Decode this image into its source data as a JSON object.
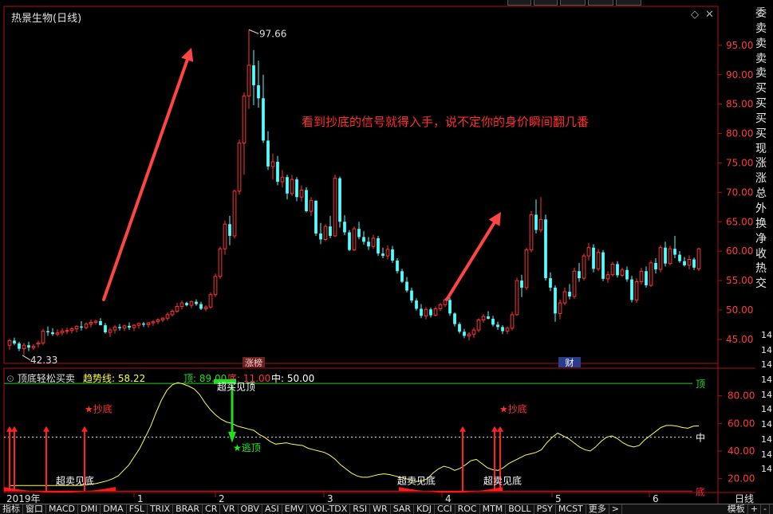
{
  "window": {
    "stock_title": "热景生物(日线)",
    "panel_controls": [
      "◇",
      "✕"
    ]
  },
  "annotation": {
    "text": "看到抄底的信号就得入手，说不定你的身价瞬间翻几番",
    "color": "#ff2d2d"
  },
  "right_panel": {
    "labels": [
      "委",
      "卖",
      "卖",
      "卖",
      "卖",
      "买",
      "买",
      "买",
      "买",
      "现",
      "涨",
      "涨",
      "总",
      "外",
      "换",
      "净",
      "收",
      "热",
      "交"
    ],
    "extra_numbers": [
      "14",
      "14",
      "14",
      "14",
      "14",
      "14",
      "14",
      "14",
      "14",
      "14"
    ]
  },
  "price_panel_labels": {
    "high_label": "97.66",
    "low_label": "42.33",
    "badge_zhangbang": "涨榜",
    "badge_cai": "财"
  },
  "indicator": {
    "name": "顶底轻松买卖",
    "trend_label": "趋势线: 58.22",
    "top_label": "顶: 89.00",
    "bottom_label": "底: 11.00",
    "mid_label": "中: 50.00",
    "line_top": "顶",
    "line_mid": "中",
    "line_bottom": "底",
    "signals": {
      "chaodi_1": "★抄底",
      "chaodi_2": "★抄底",
      "taoding": "★逃顶",
      "chaomai_top": "超买见顶",
      "chaomai_bottom_1": "超卖见底",
      "chaomai_bottom_2": "超卖见底",
      "chaomai_bottom_3": "超卖见底"
    }
  },
  "timeline": {
    "year": "2019年",
    "months": [
      "1",
      "2",
      "3",
      "4",
      "5",
      "6"
    ]
  },
  "bottom_tabs": [
    "指标",
    "窗口",
    "MACD",
    "DMI",
    "DMA",
    "FSL",
    "TRIX",
    "BRAR",
    "CR",
    "VR",
    "OBV",
    "ASI",
    "EMV",
    "VOL-TDX",
    "RSI",
    "WR",
    "SAR",
    "KDJ",
    "CCI",
    "ROC",
    "MTM",
    "BOLL",
    "PSY",
    "MCST",
    "更多",
    ">"
  ],
  "bottom_right_tabs": [
    "模板",
    "+",
    "-"
  ],
  "right_bottom_label": "日线",
  "chart_data": [
    {
      "type": "candlestick",
      "title": "热景生物(日线)",
      "ylim": [
        42,
        100
      ],
      "y_ticks": [
        45.0,
        50.0,
        55.0,
        60.0,
        65.0,
        70.0,
        75.0,
        80.0,
        85.0,
        90.0,
        95.0
      ],
      "colors": {
        "up": "#ff3232",
        "down": "#54ffff"
      },
      "candles": [
        [
          44.0,
          45.1,
          43.2,
          44.8
        ],
        [
          44.8,
          45.3,
          44.0,
          44.3
        ],
        [
          44.3,
          44.6,
          43.0,
          43.4
        ],
        [
          43.4,
          44.4,
          42.3,
          44.0
        ],
        [
          44.0,
          44.6,
          43.0,
          43.6
        ],
        [
          43.6,
          44.2,
          43.2,
          43.8
        ],
        [
          44.2,
          44.8,
          43.6,
          44.4
        ],
        [
          44.4,
          46.8,
          44.0,
          46.4
        ],
        [
          46.4,
          47.2,
          45.6,
          46.2
        ],
        [
          46.2,
          46.9,
          45.6,
          45.9
        ],
        [
          45.9,
          46.7,
          45.5,
          46.1
        ],
        [
          46.1,
          46.9,
          45.7,
          46.4
        ],
        [
          46.4,
          47.0,
          45.9,
          46.5
        ],
        [
          46.5,
          47.1,
          46.0,
          46.8
        ],
        [
          46.8,
          47.4,
          46.2,
          47.2
        ],
        [
          47.2,
          48.1,
          46.5,
          47.0
        ],
        [
          47.0,
          47.9,
          46.7,
          47.6
        ],
        [
          47.6,
          48.4,
          47.0,
          47.9
        ],
        [
          47.9,
          48.3,
          47.5,
          48.1
        ],
        [
          48.1,
          48.6,
          47.7,
          47.4
        ],
        [
          47.4,
          47.8,
          46.0,
          46.2
        ],
        [
          46.2,
          47.0,
          45.4,
          46.6
        ],
        [
          46.6,
          47.4,
          46.0,
          47.1
        ],
        [
          47.1,
          47.6,
          46.5,
          46.9
        ],
        [
          46.9,
          47.5,
          46.4,
          47.3
        ],
        [
          47.3,
          47.9,
          46.6,
          47.0
        ],
        [
          47.0,
          47.6,
          46.4,
          47.4
        ],
        [
          47.4,
          47.9,
          46.8,
          47.7
        ],
        [
          47.7,
          48.0,
          47.1,
          47.5
        ],
        [
          47.5,
          48.0,
          47.0,
          47.8
        ],
        [
          47.8,
          48.3,
          47.3,
          48.0
        ],
        [
          48.0,
          48.6,
          47.6,
          48.3
        ],
        [
          48.3,
          48.8,
          47.9,
          48.6
        ],
        [
          48.6,
          49.6,
          48.2,
          49.2
        ],
        [
          49.2,
          50.1,
          48.9,
          49.8
        ],
        [
          49.8,
          51.2,
          49.5,
          50.6
        ],
        [
          50.6,
          51.6,
          50.1,
          51.2
        ],
        [
          51.2,
          51.4,
          50.6,
          50.8
        ],
        [
          50.8,
          51.6,
          50.3,
          51.4
        ],
        [
          51.4,
          51.8,
          50.7,
          51.0
        ],
        [
          51.0,
          51.4,
          50.0,
          50.2
        ],
        [
          50.2,
          50.8,
          49.8,
          50.5
        ],
        [
          50.5,
          53.0,
          50.2,
          52.6
        ],
        [
          52.6,
          56.2,
          52.2,
          55.7
        ],
        [
          55.7,
          60.8,
          55.3,
          60.4
        ],
        [
          60.4,
          65.2,
          59.4,
          64.6
        ],
        [
          64.6,
          66.0,
          61.0,
          62.6
        ],
        [
          62.6,
          70.5,
          62.2,
          70.2
        ],
        [
          70.2,
          79.0,
          69.6,
          78.4
        ],
        [
          78.4,
          87.0,
          73.0,
          86.4
        ],
        [
          86.4,
          97.66,
          84.2,
          91.6
        ],
        [
          91.6,
          94.2,
          84.8,
          88.2
        ],
        [
          88.2,
          92.4,
          84.4,
          86.0
        ],
        [
          86.0,
          90.0,
          78.4,
          78.8
        ],
        [
          78.8,
          80.4,
          73.8,
          74.4
        ],
        [
          74.4,
          76.6,
          72.2,
          75.2
        ],
        [
          75.2,
          76.2,
          71.2,
          71.8
        ],
        [
          71.8,
          73.8,
          70.8,
          72.6
        ],
        [
          72.6,
          73.0,
          68.8,
          69.8
        ],
        [
          69.8,
          73.0,
          69.4,
          72.2
        ],
        [
          72.2,
          72.6,
          68.5,
          69.2
        ],
        [
          69.2,
          71.2,
          68.4,
          70.4
        ],
        [
          70.4,
          70.9,
          66.6,
          66.8
        ],
        [
          66.8,
          69.2,
          66.0,
          68.6
        ],
        [
          68.6,
          68.6,
          62.6,
          63.0
        ],
        [
          63.0,
          64.8,
          61.2,
          62.0
        ],
        [
          62.0,
          64.6,
          61.7,
          64.2
        ],
        [
          64.2,
          66.0,
          62.2,
          62.6
        ],
        [
          62.6,
          73.0,
          62.4,
          72.4
        ],
        [
          72.4,
          72.7,
          64.0,
          65.0
        ],
        [
          65.0,
          66.1,
          62.7,
          63.2
        ],
        [
          63.2,
          63.6,
          60.0,
          60.2
        ],
        [
          60.2,
          64.2,
          60.0,
          63.8
        ],
        [
          63.8,
          65.0,
          62.0,
          62.4
        ],
        [
          62.4,
          63.4,
          61.1,
          61.6
        ],
        [
          61.6,
          62.4,
          60.2,
          60.8
        ],
        [
          60.8,
          62.8,
          60.4,
          62.2
        ],
        [
          62.2,
          62.6,
          59.2,
          59.6
        ],
        [
          59.6,
          60.6,
          58.8,
          59.2
        ],
        [
          59.2,
          61.0,
          58.6,
          60.3
        ],
        [
          60.3,
          60.9,
          58.0,
          58.4
        ],
        [
          58.4,
          58.8,
          56.2,
          56.6
        ],
        [
          56.6,
          57.0,
          54.6,
          54.8
        ],
        [
          54.8,
          55.6,
          53.0,
          53.3
        ],
        [
          53.3,
          53.8,
          51.2,
          51.6
        ],
        [
          51.6,
          52.0,
          49.9,
          50.2
        ],
        [
          50.2,
          51.0,
          48.6,
          49.0
        ],
        [
          49.0,
          50.5,
          48.4,
          50.1
        ],
        [
          50.1,
          50.4,
          48.7,
          49.1
        ],
        [
          49.1,
          50.6,
          48.9,
          50.2
        ],
        [
          50.2,
          51.2,
          49.8,
          50.9
        ],
        [
          50.9,
          52.0,
          50.5,
          51.7
        ],
        [
          51.7,
          52.1,
          49.0,
          49.4
        ],
        [
          49.4,
          49.6,
          47.2,
          47.6
        ],
        [
          47.6,
          47.9,
          46.0,
          46.3
        ],
        [
          46.3,
          46.8,
          45.2,
          45.6
        ],
        [
          45.6,
          46.2,
          44.8,
          45.9
        ],
        [
          45.9,
          47.0,
          45.2,
          46.6
        ],
        [
          46.6,
          48.6,
          46.2,
          48.3
        ],
        [
          48.3,
          49.3,
          47.8,
          48.9
        ],
        [
          48.9,
          49.8,
          48.4,
          48.5
        ],
        [
          48.5,
          49.0,
          47.2,
          47.5
        ],
        [
          47.5,
          48.0,
          46.6,
          47.1
        ],
        [
          47.1,
          47.4,
          45.9,
          46.4
        ],
        [
          46.4,
          47.2,
          45.9,
          46.9
        ],
        [
          46.9,
          49.7,
          46.5,
          49.2
        ],
        [
          49.2,
          55.5,
          49.0,
          55.0
        ],
        [
          55.0,
          56.0,
          52.2,
          53.8
        ],
        [
          53.8,
          60.6,
          53.4,
          60.2
        ],
        [
          60.2,
          66.8,
          59.8,
          66.2
        ],
        [
          66.2,
          68.8,
          63.0,
          63.6
        ],
        [
          63.6,
          69.2,
          63.2,
          65.4
        ],
        [
          65.4,
          66.2,
          55.0,
          55.4
        ],
        [
          55.4,
          56.4,
          53.2,
          53.8
        ],
        [
          53.8,
          54.2,
          48.0,
          49.4
        ],
        [
          49.4,
          51.8,
          48.4,
          51.2
        ],
        [
          51.2,
          53.8,
          50.8,
          53.1
        ],
        [
          53.1,
          54.4,
          51.8,
          52.3
        ],
        [
          52.3,
          57.2,
          51.9,
          56.6
        ],
        [
          56.6,
          58.0,
          54.8,
          55.4
        ],
        [
          55.4,
          59.6,
          55.0,
          59.2
        ],
        [
          59.2,
          61.4,
          58.4,
          60.6
        ],
        [
          60.6,
          61.2,
          56.4,
          57.0
        ],
        [
          57.0,
          60.4,
          56.6,
          59.8
        ],
        [
          59.8,
          60.2,
          54.9,
          55.3
        ],
        [
          55.3,
          56.6,
          54.6,
          56.0
        ],
        [
          56.0,
          58.2,
          55.7,
          57.8
        ],
        [
          57.8,
          58.3,
          55.5,
          55.9
        ],
        [
          55.9,
          57.2,
          55.6,
          56.8
        ],
        [
          56.8,
          57.4,
          54.8,
          55.2
        ],
        [
          55.2,
          55.8,
          51.3,
          51.7
        ],
        [
          51.7,
          55.4,
          51.2,
          54.8
        ],
        [
          54.8,
          57.2,
          54.3,
          56.6
        ],
        [
          56.6,
          57.4,
          53.8,
          54.2
        ],
        [
          54.2,
          58.4,
          53.9,
          58.0
        ],
        [
          58.0,
          58.8,
          56.2,
          56.9
        ],
        [
          56.9,
          61.0,
          56.4,
          60.6
        ],
        [
          60.6,
          61.6,
          57.4,
          57.9
        ],
        [
          57.9,
          60.9,
          57.6,
          60.4
        ],
        [
          60.4,
          62.6,
          58.8,
          59.4
        ],
        [
          59.4,
          60.0,
          58.0,
          58.3
        ],
        [
          58.3,
          59.0,
          57.4,
          57.6
        ],
        [
          57.6,
          59.3,
          56.9,
          58.6
        ],
        [
          58.6,
          58.9,
          56.8,
          57.2
        ],
        [
          57.0,
          60.6,
          56.6,
          60.4
        ]
      ]
    },
    {
      "type": "line",
      "title": "顶底轻松买卖",
      "ylim": [
        10,
        100
      ],
      "y_ticks": [
        20.0,
        40.0,
        60.0,
        80.0
      ],
      "ref_lines": {
        "top": 89,
        "mid": 50,
        "bottom": 11
      },
      "series": [
        {
          "name": "趋势线",
          "color": "#ffff55",
          "values": [
            15.0,
            15.0,
            15.0,
            15.0,
            15.0,
            15.0,
            15.0,
            15.0,
            15.0,
            15.0,
            15.0,
            15.0,
            15.0,
            15.0,
            15.5,
            16.0,
            16.5,
            17.5,
            18.5,
            20.0,
            22.0,
            26.0,
            30.0,
            36.0,
            42.0,
            50.0,
            58.0,
            68.0,
            77.0,
            84.0,
            88.0,
            89.5,
            88.5,
            87.0,
            85.0,
            81.0,
            75.0,
            70.0,
            66.0,
            63.0,
            61.0,
            60.0,
            58.0,
            57.0,
            56.0,
            55.0,
            52.0,
            50.0,
            47.0,
            45.0,
            45.5,
            46.0,
            45.0,
            44.5,
            44.0,
            42.0,
            41.0,
            40.0,
            39.0,
            37.0,
            34.0,
            30.0,
            27.0,
            24.0,
            22.0,
            21.0,
            21.0,
            22.0,
            23.0,
            23.5,
            23.0,
            22.0,
            21.0,
            20.0,
            19.0,
            18.0,
            18.5,
            20.0,
            24.0,
            27.0,
            29.0,
            28.0,
            26.0,
            27.5,
            30.0,
            33.0,
            34.0,
            31.0,
            28.0,
            26.5,
            26.0,
            28.0,
            31.0,
            33.0,
            35.0,
            37.0,
            38.0,
            39.0,
            41.0,
            46.0,
            50.0,
            53.0,
            51.0,
            49.0,
            46.0,
            43.0,
            41.0,
            40.0,
            43.0,
            47.0,
            50.0,
            51.0,
            49.0,
            46.0,
            44.0,
            43.0,
            44.0,
            48.0,
            51.0,
            54.0,
            57.0,
            58.5,
            58.5,
            58.0,
            57.0,
            56.5,
            58.0,
            58.22
          ]
        }
      ]
    }
  ]
}
